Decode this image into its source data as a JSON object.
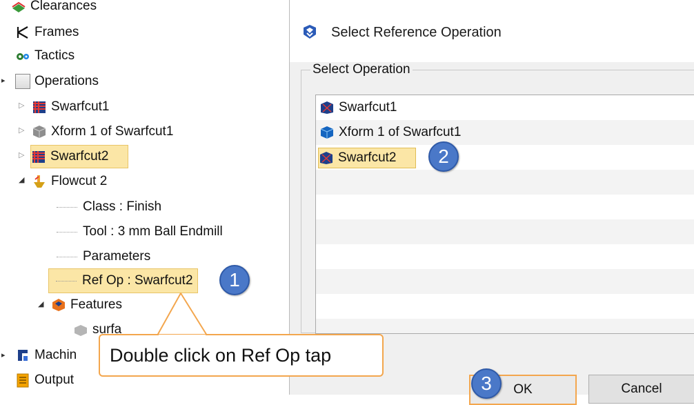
{
  "tree": {
    "items": [
      {
        "label": "Clearances"
      },
      {
        "label": "Frames"
      },
      {
        "label": "Tactics"
      },
      {
        "label": "Operations"
      },
      {
        "label": "Swarfcut1"
      },
      {
        "label": "Xform 1 of Swarfcut1"
      },
      {
        "label": "Swarfcut2"
      },
      {
        "label": "Flowcut 2"
      },
      {
        "label": "Class : Finish"
      },
      {
        "label": "Tool : 3 mm Ball Endmill"
      },
      {
        "label": "Parameters"
      },
      {
        "label": "Ref Op : Swarfcut2"
      },
      {
        "label": "Features"
      },
      {
        "label": "surfa"
      },
      {
        "label": "Machin"
      },
      {
        "label": "Output"
      }
    ]
  },
  "dialog": {
    "title": "Select Reference Operation",
    "group_label": "Select Operation",
    "operations": [
      {
        "label": "Swarfcut1"
      },
      {
        "label": "Xform 1 of Swarfcut1"
      },
      {
        "label": "Swarfcut2",
        "selected": true
      }
    ],
    "ok_label": "OK",
    "cancel_label": "Cancel"
  },
  "annotations": {
    "step1": "1",
    "step2": "2",
    "step3": "3",
    "callout_text": "Double click on Ref Op tap"
  },
  "colors": {
    "highlight": "#fbe6a6",
    "callout_border": "#f3a64d",
    "badge": "#4a78c8"
  }
}
